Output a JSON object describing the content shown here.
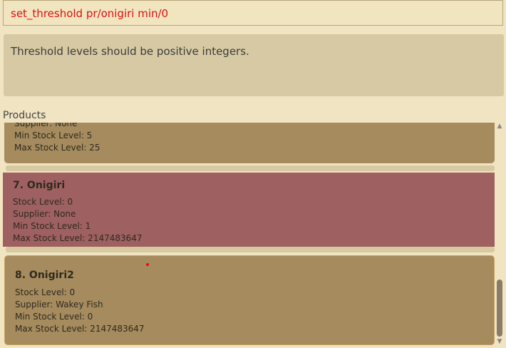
{
  "command_box": {
    "text": "set_threshold pr/onigiri min/0"
  },
  "result_box": {
    "text": "Threshold levels should be positive integers."
  },
  "products_panel": {
    "label": "Products",
    "items": [
      {
        "supplier": "Supplier: None",
        "min_stock": "Min Stock Level: 5",
        "max_stock": "Max Stock Level: 25"
      },
      {
        "title": "7. Onigiri",
        "stock": "Stock Level: 0",
        "supplier": "Supplier: None",
        "min_stock": "Min Stock Level: 1",
        "max_stock": "Max Stock Level: 2147483647"
      },
      {
        "title": "8. Onigiri2",
        "stock": "Stock Level: 0",
        "supplier": "Supplier: Wakey Fish",
        "min_stock": "Min Stock Level: 0",
        "max_stock": "Max Stock Level: 2147483647"
      }
    ]
  },
  "scrollbar": {
    "up_icon": "chevron-up-icon",
    "down_icon": "chevron-down-icon"
  },
  "colors": {
    "background": "#f0e4c3",
    "command_text": "#e01010",
    "card": "#a58b5d",
    "selected_card": "#9e6060"
  }
}
